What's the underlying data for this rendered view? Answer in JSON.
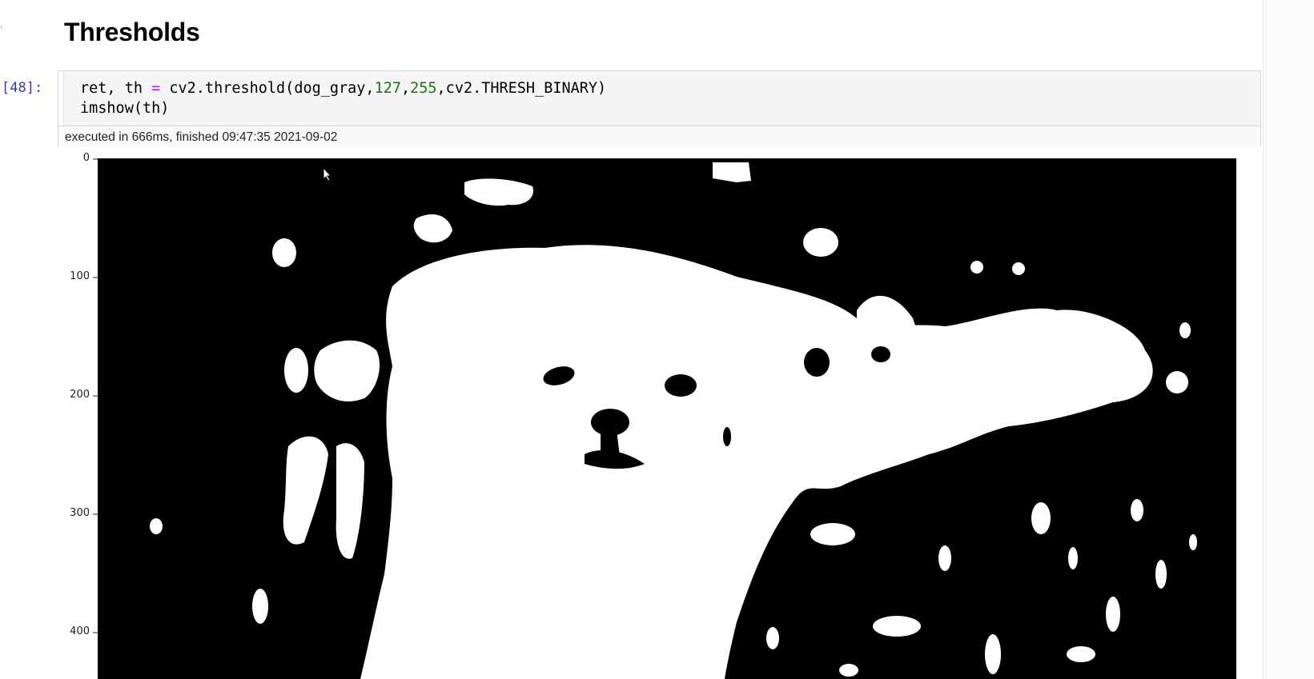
{
  "notebook": {
    "section_heading": "Thresholds",
    "cell": {
      "prompt": "[48]:",
      "code_lines": [
        "ret, th = cv2.threshold(dog_gray,127,255,cv2.THRESH_BINARY)",
        "imshow(th)"
      ],
      "execution_info": "executed in 666ms, finished 09:47:35 2021-09-02"
    }
  },
  "output_plot": {
    "image_description_icon": "binary-threshold-dog-image",
    "y_ticks": [
      "0",
      "100",
      "200",
      "300",
      "400"
    ],
    "colors": {
      "foreground": "#ffffff",
      "background": "#000000"
    }
  },
  "colors": {
    "prompt": "#303f9f",
    "keyword_operator": "#aa22ff",
    "number_literal": "#117711"
  }
}
